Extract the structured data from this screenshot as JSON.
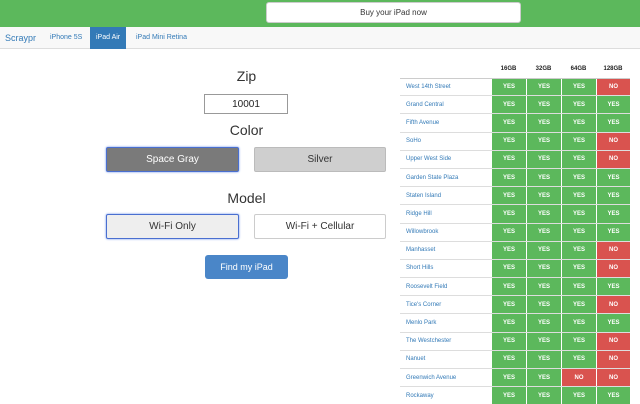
{
  "topbar": {
    "buy_label": "Buy your iPad now"
  },
  "nav": {
    "brand": "Scraypr",
    "tabs": [
      {
        "label": "iPhone 5S"
      },
      {
        "label": "iPad Air",
        "active": true
      },
      {
        "label": "iPad Mini Retina"
      }
    ]
  },
  "form": {
    "zip_label": "Zip",
    "zip_value": "10001",
    "color_label": "Color",
    "color_options": [
      "Space Gray",
      "Silver"
    ],
    "color_selected": "Space Gray",
    "model_label": "Model",
    "model_options": [
      "Wi-Fi Only",
      "Wi-Fi + Cellular"
    ],
    "model_selected": "Wi-Fi Only",
    "find_label": "Find my iPad"
  },
  "stock": {
    "capacities": [
      "16GB",
      "32GB",
      "64GB",
      "128GB"
    ],
    "rows": [
      {
        "store": "West 14th Street",
        "avail": [
          "YES",
          "YES",
          "YES",
          "NO"
        ]
      },
      {
        "store": "Grand Central",
        "avail": [
          "YES",
          "YES",
          "YES",
          "YES"
        ]
      },
      {
        "store": "Fifth Avenue",
        "avail": [
          "YES",
          "YES",
          "YES",
          "YES"
        ]
      },
      {
        "store": "SoHo",
        "avail": [
          "YES",
          "YES",
          "YES",
          "NO"
        ]
      },
      {
        "store": "Upper West Side",
        "avail": [
          "YES",
          "YES",
          "YES",
          "NO"
        ]
      },
      {
        "store": "Garden State Plaza",
        "avail": [
          "YES",
          "YES",
          "YES",
          "YES"
        ]
      },
      {
        "store": "Staten Island",
        "avail": [
          "YES",
          "YES",
          "YES",
          "YES"
        ]
      },
      {
        "store": "Ridge Hill",
        "avail": [
          "YES",
          "YES",
          "YES",
          "YES"
        ]
      },
      {
        "store": "Willowbrook",
        "avail": [
          "YES",
          "YES",
          "YES",
          "YES"
        ]
      },
      {
        "store": "Manhasset",
        "avail": [
          "YES",
          "YES",
          "YES",
          "NO"
        ]
      },
      {
        "store": "Short Hills",
        "avail": [
          "YES",
          "YES",
          "YES",
          "NO"
        ]
      },
      {
        "store": "Roosevelt Field",
        "avail": [
          "YES",
          "YES",
          "YES",
          "YES"
        ]
      },
      {
        "store": "Tice's Corner",
        "avail": [
          "YES",
          "YES",
          "YES",
          "NO"
        ]
      },
      {
        "store": "Menlo Park",
        "avail": [
          "YES",
          "YES",
          "YES",
          "YES"
        ]
      },
      {
        "store": "The Westchester",
        "avail": [
          "YES",
          "YES",
          "YES",
          "NO"
        ]
      },
      {
        "store": "Nanuet",
        "avail": [
          "YES",
          "YES",
          "YES",
          "NO"
        ]
      },
      {
        "store": "Greenwich Avenue",
        "avail": [
          "YES",
          "YES",
          "NO",
          "NO"
        ]
      },
      {
        "store": "Rockaway",
        "avail": [
          "YES",
          "YES",
          "YES",
          "YES"
        ]
      }
    ]
  },
  "colors": {
    "yes": "#5cb85c",
    "no": "#d9534f",
    "accent": "#337ab7"
  }
}
